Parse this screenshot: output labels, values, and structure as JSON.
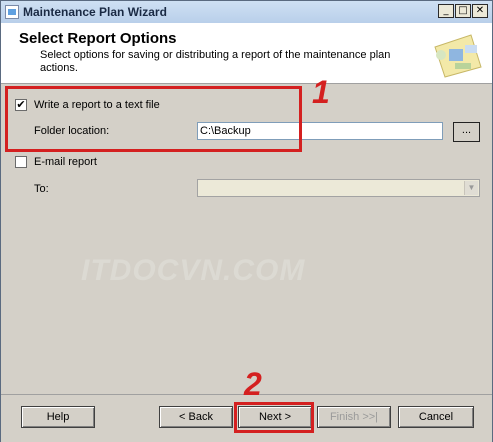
{
  "window": {
    "title": "Maintenance Plan Wizard",
    "minimize_glyph": "_",
    "maximize_glyph": "□",
    "close_glyph": "✕"
  },
  "header": {
    "title": "Select Report Options",
    "description": "Select options for saving or distributing a report of the maintenance plan actions."
  },
  "options": {
    "write_report": {
      "label": "Write a report to a text file",
      "checked": true
    },
    "folder_location": {
      "label": "Folder location:",
      "value": "C:\\Backup",
      "browse_label": "..."
    },
    "email_report": {
      "label": "E-mail report",
      "checked": false
    },
    "to": {
      "label": "To:",
      "value": ""
    }
  },
  "watermark": "ITDOCVN.COM",
  "footer": {
    "help": "Help",
    "back": "< Back",
    "next": "Next >",
    "finish": "Finish >>|",
    "cancel": "Cancel"
  },
  "annotations": {
    "step1": "1",
    "step2": "2"
  },
  "colors": {
    "annotation": "#d42020",
    "titlebar": "#c3d7ee",
    "dialog_bg": "#d4d0c8"
  }
}
